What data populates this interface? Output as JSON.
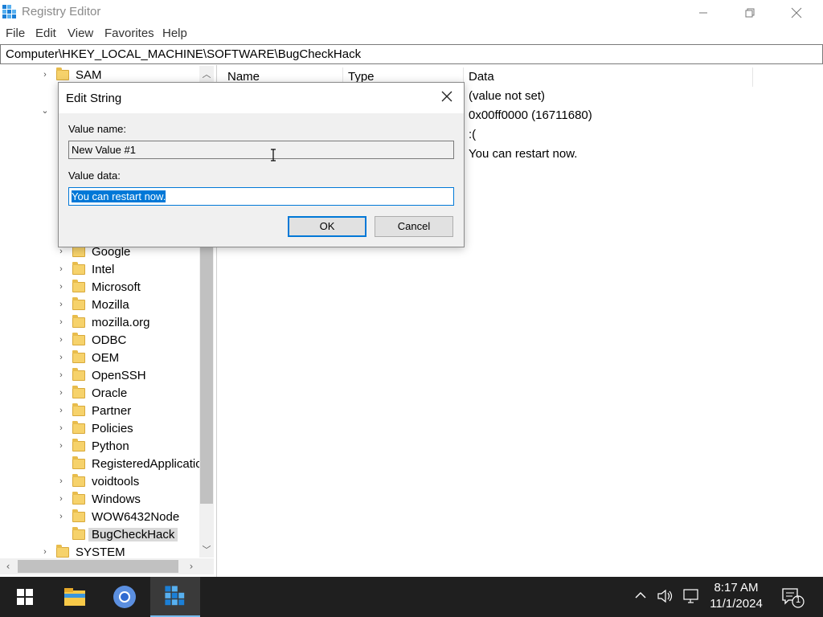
{
  "window": {
    "title": "Registry Editor"
  },
  "menu": [
    "File",
    "Edit",
    "View",
    "Favorites",
    "Help"
  ],
  "address": "Computer\\HKEY_LOCAL_MACHINE\\SOFTWARE\\BugCheckHack",
  "tree": {
    "top_items": [
      {
        "label": "SAM",
        "expander": "›"
      }
    ],
    "items": [
      {
        "label": "Google",
        "expander": "›"
      },
      {
        "label": "Intel",
        "expander": "›"
      },
      {
        "label": "Microsoft",
        "expander": "›"
      },
      {
        "label": "Mozilla",
        "expander": "›"
      },
      {
        "label": "mozilla.org",
        "expander": "›"
      },
      {
        "label": "ODBC",
        "expander": "›"
      },
      {
        "label": "OEM",
        "expander": "›"
      },
      {
        "label": "OpenSSH",
        "expander": "›"
      },
      {
        "label": "Oracle",
        "expander": "›"
      },
      {
        "label": "Partner",
        "expander": "›"
      },
      {
        "label": "Policies",
        "expander": "›"
      },
      {
        "label": "Python",
        "expander": "›"
      },
      {
        "label": "RegisteredApplicatic",
        "expander": ""
      },
      {
        "label": "voidtools",
        "expander": "›"
      },
      {
        "label": "Windows",
        "expander": "›"
      },
      {
        "label": "WOW6432Node",
        "expander": "›"
      },
      {
        "label": "BugCheckHack",
        "expander": "",
        "selected": true
      }
    ],
    "bottom_items": [
      {
        "label": "SYSTEM",
        "expander": "›"
      }
    ]
  },
  "list": {
    "columns": [
      "Name",
      "Type",
      "Data"
    ],
    "data_values": [
      "(value not set)",
      "0x00ff0000 (16711680)",
      ":(",
      "You can restart now."
    ]
  },
  "dialog": {
    "title": "Edit String",
    "value_name_label": "Value name:",
    "value_name": "New Value #1",
    "value_data_label": "Value data:",
    "value_data": "You can restart now.",
    "ok_label": "OK",
    "cancel_label": "Cancel"
  },
  "taskbar": {
    "time": "8:17 AM",
    "date": "11/1/2024",
    "notification_count": "1"
  },
  "colors": {
    "accent": "#0078d7",
    "taskbar": "#1f1f1f",
    "folder": "#f6d26b"
  }
}
